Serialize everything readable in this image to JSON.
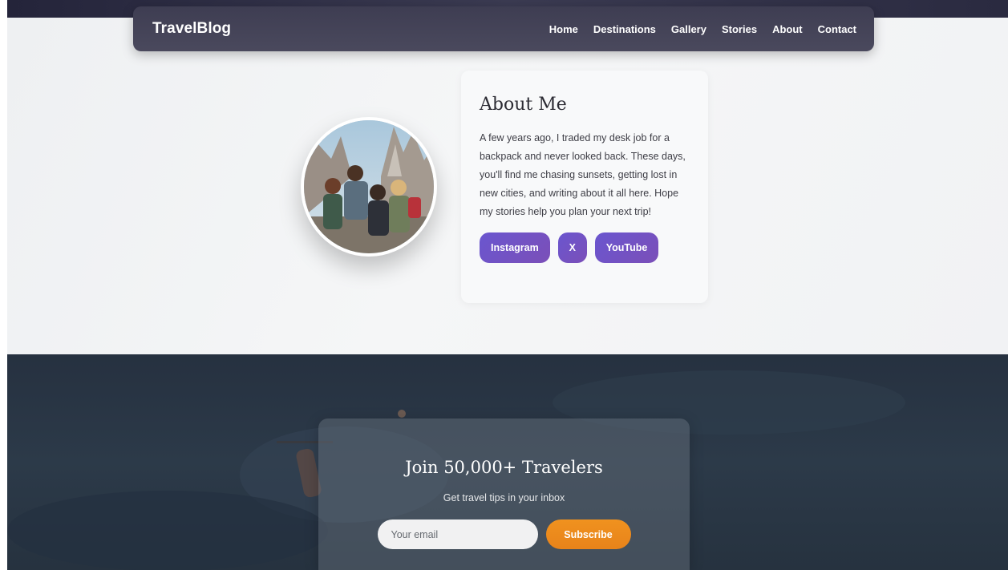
{
  "nav": {
    "brand": "TravelBlog",
    "links": [
      "Home",
      "Destinations",
      "Gallery",
      "Stories",
      "About",
      "Contact"
    ]
  },
  "about": {
    "title": "About Me",
    "text": "A few years ago, I traded my desk job for a backpack and never looked back. These days, you'll find me chasing sunsets, getting lost in new cities, and writing about it all here. Hope my stories help you plan your next trip!",
    "social": [
      "Instagram",
      "X",
      "YouTube"
    ]
  },
  "newsletter": {
    "title": "Join 50,000+ Travelers",
    "subtitle": "Get travel tips in your inbox",
    "email_placeholder": "Your email",
    "subscribe_label": "Subscribe"
  },
  "colors": {
    "nav_bg": "#46455a",
    "accent_purple": "#6a56cf",
    "subscribe_orange": "#ec8a1d",
    "ocean": "#2a3746"
  }
}
